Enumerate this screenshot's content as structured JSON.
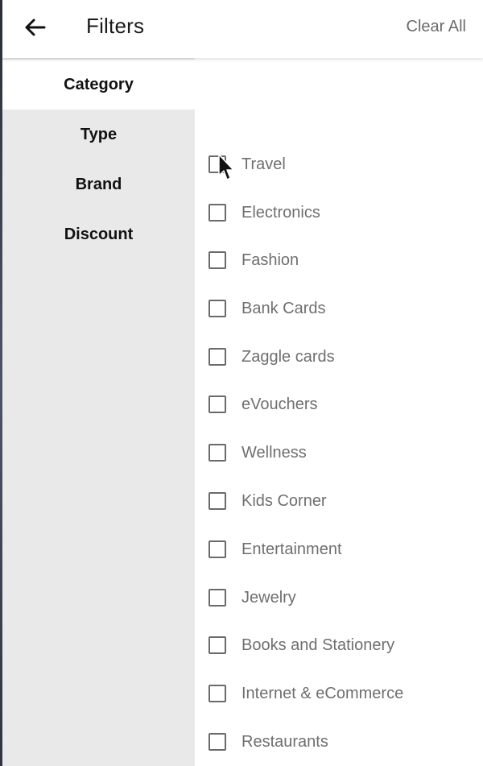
{
  "header": {
    "back_icon": "arrow-left-icon",
    "title": "Filters",
    "clear_all": "Clear All"
  },
  "sidebar": {
    "items": [
      {
        "label": "Category",
        "active": true
      },
      {
        "label": "Type",
        "active": false
      },
      {
        "label": "Brand",
        "active": false
      },
      {
        "label": "Discount",
        "active": false
      }
    ]
  },
  "options": [
    {
      "label": "Travel",
      "checked": false
    },
    {
      "label": "Electronics",
      "checked": false
    },
    {
      "label": "Fashion",
      "checked": false
    },
    {
      "label": "Bank Cards",
      "checked": false
    },
    {
      "label": "Zaggle cards",
      "checked": false
    },
    {
      "label": "eVouchers",
      "checked": false
    },
    {
      "label": "Wellness",
      "checked": false
    },
    {
      "label": "Kids Corner",
      "checked": false
    },
    {
      "label": "Entertainment",
      "checked": false
    },
    {
      "label": "Jewelry",
      "checked": false
    },
    {
      "label": "Books and Stationery",
      "checked": false
    },
    {
      "label": "Internet & eCommerce",
      "checked": false
    },
    {
      "label": "Restaurants",
      "checked": false
    }
  ],
  "colors": {
    "sidebar_bg": "#e9e9ea",
    "label_text": "#6f6f6f",
    "checkbox_border": "#6a6a6a"
  }
}
